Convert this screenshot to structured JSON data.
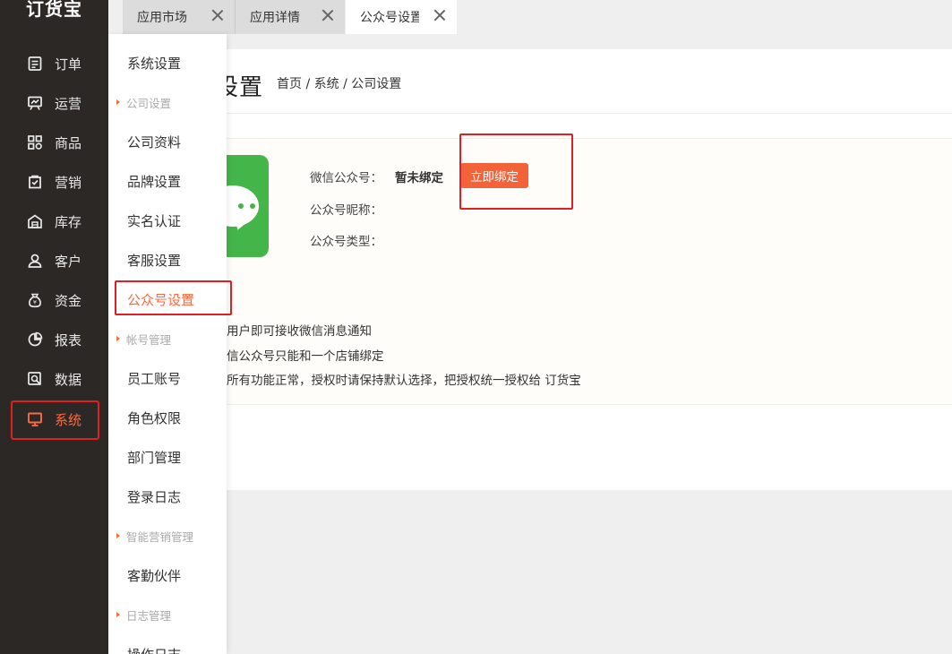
{
  "app": {
    "logo": "订货宝"
  },
  "sidebar": {
    "items": [
      {
        "label": "订单",
        "icon": "order-icon"
      },
      {
        "label": "运营",
        "icon": "operation-icon"
      },
      {
        "label": "商品",
        "icon": "goods-icon"
      },
      {
        "label": "营销",
        "icon": "marketing-icon"
      },
      {
        "label": "库存",
        "icon": "warehouse-icon"
      },
      {
        "label": "客户",
        "icon": "user-icon"
      },
      {
        "label": "资金",
        "icon": "money-bag-icon"
      },
      {
        "label": "报表",
        "icon": "pie-chart-icon"
      },
      {
        "label": "数据",
        "icon": "data-search-icon"
      },
      {
        "label": "系统",
        "icon": "monitor-icon",
        "active": true
      }
    ]
  },
  "submenu": {
    "items": [
      {
        "type": "item",
        "label": "系统设置"
      },
      {
        "type": "group",
        "label": "公司设置"
      },
      {
        "type": "item",
        "label": "公司资料"
      },
      {
        "type": "item",
        "label": "品牌设置"
      },
      {
        "type": "item",
        "label": "实名认证"
      },
      {
        "type": "item",
        "label": "客服设置"
      },
      {
        "type": "item",
        "label": "公众号设置",
        "active": true
      },
      {
        "type": "group",
        "label": "帐号管理"
      },
      {
        "type": "item",
        "label": "员工账号"
      },
      {
        "type": "item",
        "label": "角色权限"
      },
      {
        "type": "item",
        "label": "部门管理"
      },
      {
        "type": "item",
        "label": "登录日志"
      },
      {
        "type": "group",
        "label": "智能营销管理"
      },
      {
        "type": "item",
        "label": "客勤伙伴"
      },
      {
        "type": "group",
        "label": "日志管理"
      },
      {
        "type": "item",
        "label": "操作日志"
      }
    ]
  },
  "tabs": [
    {
      "label": "应用市场"
    },
    {
      "label": "应用详情"
    },
    {
      "label": "公众号设置",
      "active": true
    }
  ],
  "main": {
    "title": "设置",
    "breadcrumb": "首页 / 系统 / 公司设置",
    "wechat": {
      "account_label": "微信公众号：",
      "account_value": "暂未绑定",
      "bind_button": "立即绑定",
      "nickname_label": "公众号昵称：",
      "type_label": "公众号类型："
    },
    "notes": [
      "用户即可接收微信消息通知",
      "信公众号只能和一个店铺绑定",
      "所有功能正常，授权时请保持默认选择，把授权统一授权给 订货宝"
    ]
  },
  "colors": {
    "accent": "#ff6a3d",
    "sidebar_bg": "#2c2826",
    "wechat_green": "#44b549",
    "highlight_red": "#e02020"
  }
}
